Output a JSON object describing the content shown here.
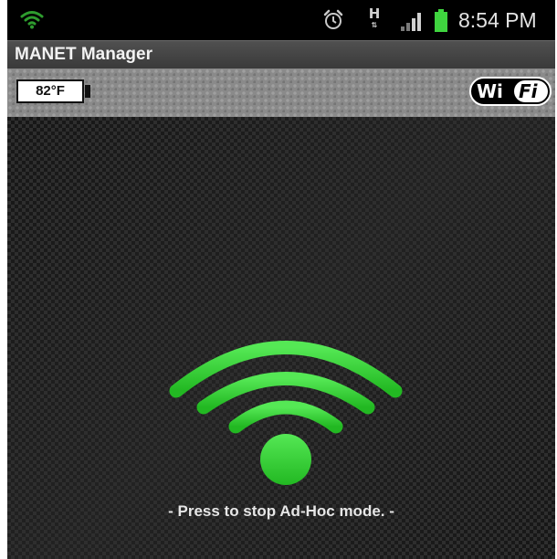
{
  "status_bar": {
    "time": "8:54 PM",
    "network_type": "H",
    "icons": [
      "wifi-icon",
      "alarm-clock-icon",
      "hspa-data-icon",
      "signal-strength-icon",
      "battery-icon"
    ]
  },
  "app": {
    "title": "MANET Manager"
  },
  "toolbar": {
    "temperature": "82°F",
    "wifi_logo_wi": "Wi",
    "wifi_logo_fi": "Fi"
  },
  "main": {
    "toggle_icon": "wifi-toggle-icon",
    "instruction": "- Press to stop Ad-Hoc mode. -"
  },
  "colors": {
    "accent_green": "#3cd23c",
    "status_battery_green": "#3fd43f",
    "status_wifi_green": "#2e9c2e"
  }
}
